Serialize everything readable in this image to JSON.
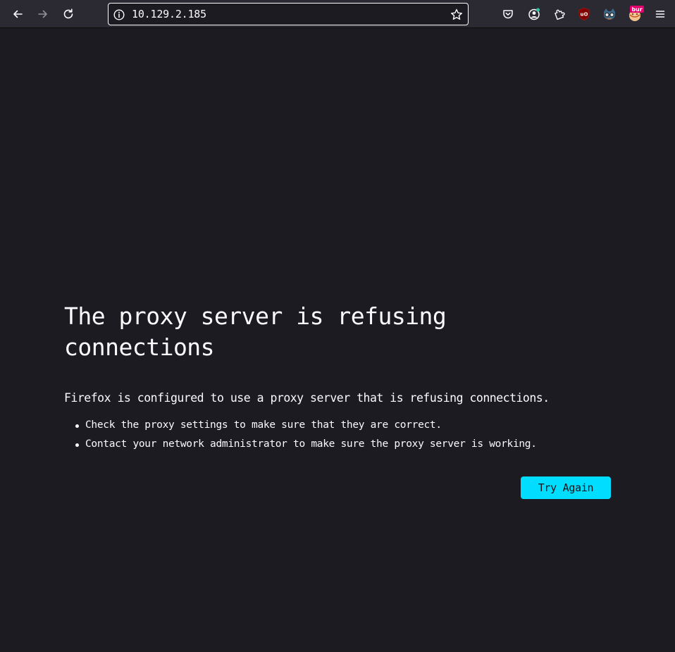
{
  "toolbar": {
    "back_icon": "arrow-left-icon",
    "forward_icon": "arrow-right-icon",
    "reload_icon": "reload-icon",
    "url": "10.129.2.185",
    "site_info_icon": "info-icon",
    "bookmark_icon": "star-icon",
    "extensions": [
      {
        "name": "pocket",
        "icon": "pocket-icon"
      },
      {
        "name": "account",
        "icon": "account-icon"
      },
      {
        "name": "extensions",
        "icon": "puzzle-icon"
      },
      {
        "name": "ublock-origin",
        "icon": "ublock-origin-icon",
        "badge": "uO"
      },
      {
        "name": "foxyproxy",
        "icon": "foxyproxy-icon"
      },
      {
        "name": "burp",
        "icon": "burp-icon",
        "badge": "bur"
      },
      {
        "name": "menu",
        "icon": "hamburger-menu-icon"
      }
    ],
    "colors": {
      "toolbar_bg": "#2b2a33",
      "page_bg": "#1c1b22",
      "accent": "#00ddff",
      "text": "#fbfbfe"
    }
  },
  "error": {
    "title_line1": "The proxy server is refusing",
    "title_line2": "connections",
    "description": "Firefox is configured to use a proxy server that is refusing connections.",
    "suggestions": [
      "Check the proxy settings to make sure that they are correct.",
      "Contact your network administrator to make sure the proxy server is working."
    ],
    "button_label": "Try Again"
  }
}
